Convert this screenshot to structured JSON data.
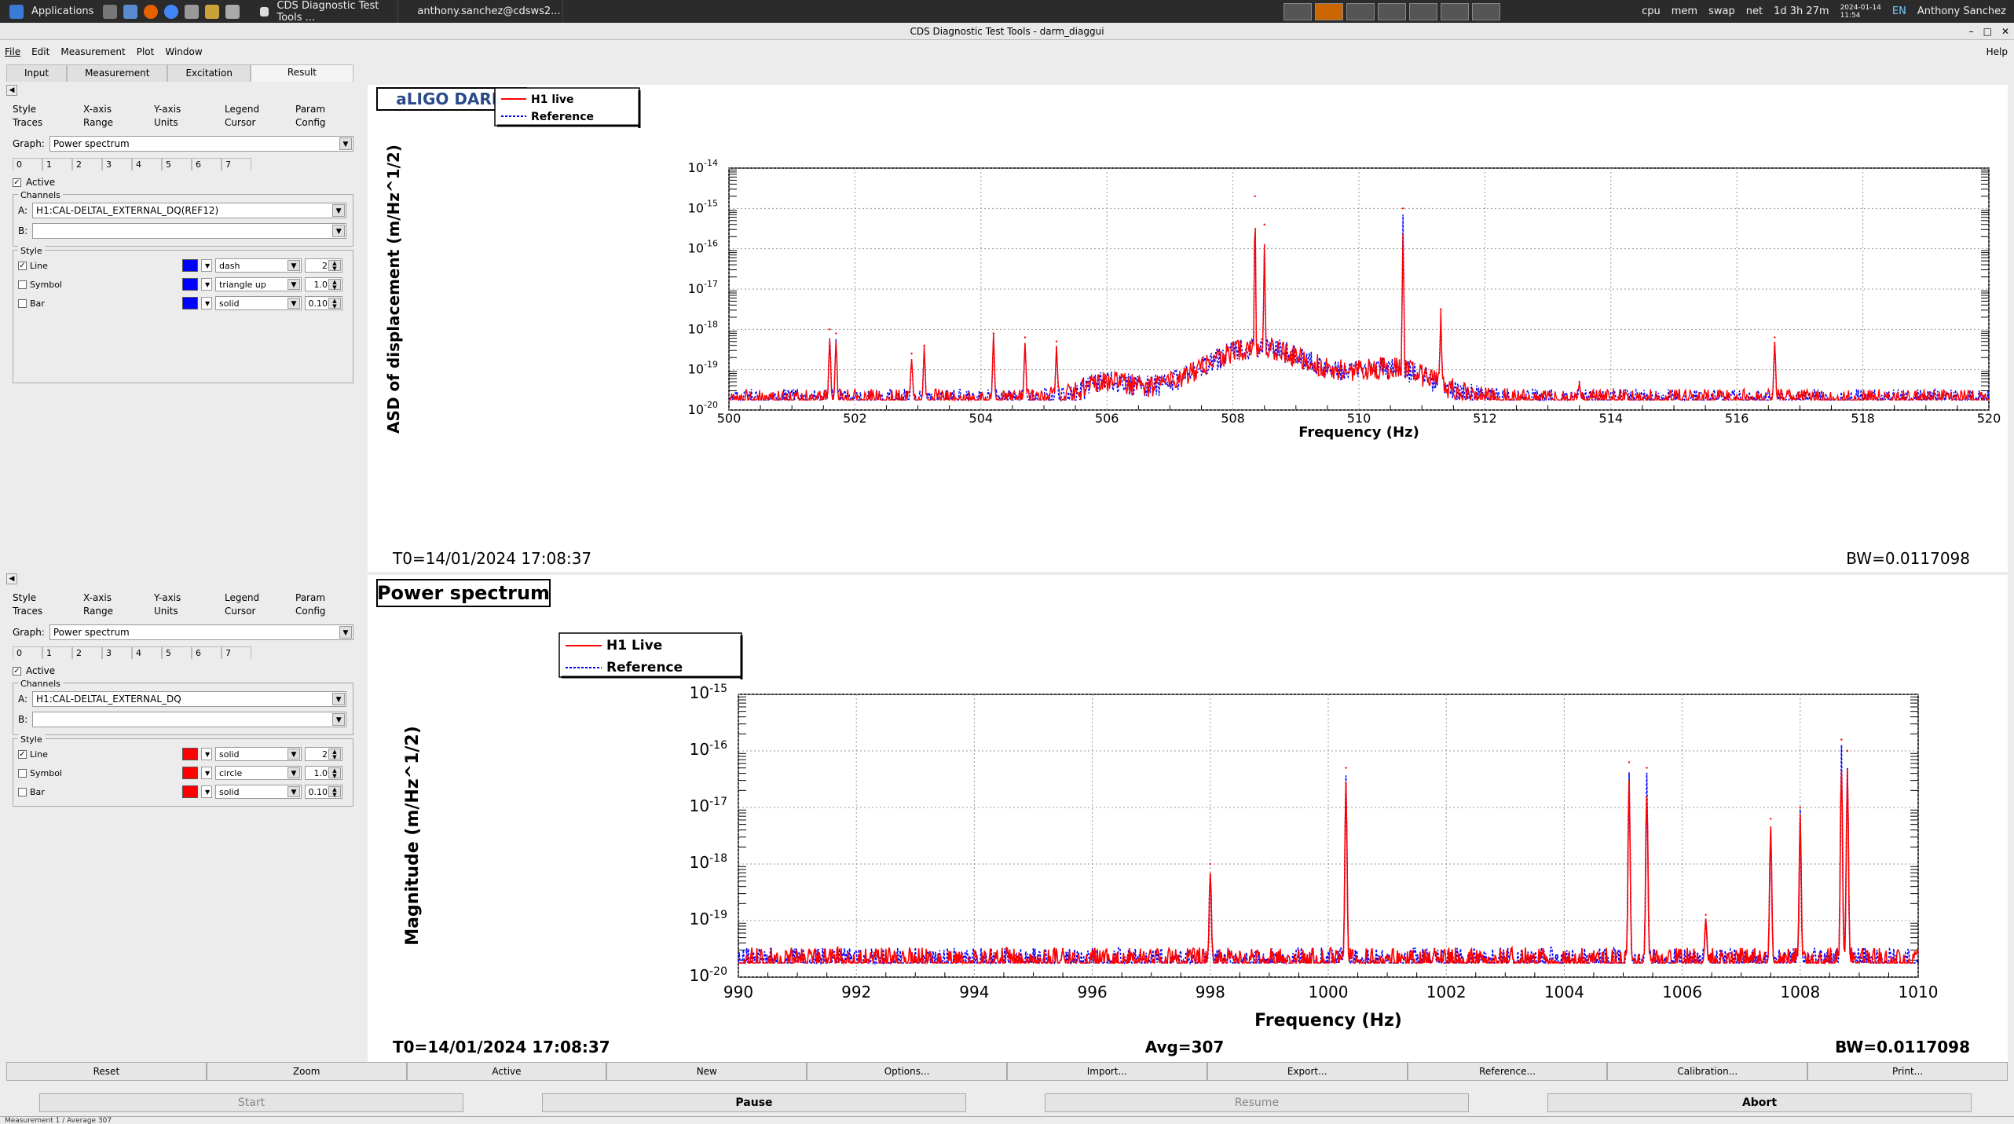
{
  "taskbar": {
    "applications": "Applications",
    "task1": "CDS Diagnostic Test Tools ...",
    "task2": "anthony.sanchez@cdsws2...",
    "tray": [
      "cpu",
      "mem",
      "swap",
      "net"
    ],
    "uptime": "1d 3h 27m",
    "date": "2024-01-14",
    "time": "11:54",
    "lang": "EN",
    "user": "Anthony Sanchez"
  },
  "window": {
    "title": "CDS Diagnostic Test Tools - darm_diaggui"
  },
  "menu": [
    "File",
    "Edit",
    "Measurement",
    "Plot",
    "Window"
  ],
  "help": "Help",
  "main_tabs": [
    "Input",
    "Measurement",
    "Excitation",
    "Result"
  ],
  "panels": [
    {
      "subtabs_r1": [
        "Style",
        "X-axis",
        "Y-axis",
        "Legend",
        "Param"
      ],
      "subtabs_r2": [
        "Traces",
        "Range",
        "Units",
        "Cursor",
        "Config"
      ],
      "graph_label": "Graph:",
      "graph_value": "Power spectrum",
      "trace_tabs": [
        "0",
        "1",
        "2",
        "3",
        "4",
        "5",
        "6",
        "7"
      ],
      "active_label": "Active",
      "channels_label": "Channels",
      "chan_a_label": "A:",
      "chan_a": "H1:CAL-DELTAL_EXTERNAL_DQ(REF12)",
      "chan_b_label": "B:",
      "style_label": "Style",
      "line_label": "Line",
      "line_style": "dash",
      "line_width": "2",
      "symbol_label": "Symbol",
      "symbol_style": "triangle up",
      "symbol_size": "1.0",
      "bar_label": "Bar",
      "bar_style": "solid",
      "bar_width": "0.10",
      "color": "#0000ff"
    },
    {
      "subtabs_r1": [
        "Style",
        "X-axis",
        "Y-axis",
        "Legend",
        "Param"
      ],
      "subtabs_r2": [
        "Traces",
        "Range",
        "Units",
        "Cursor",
        "Config"
      ],
      "graph_label": "Graph:",
      "graph_value": "Power spectrum",
      "trace_tabs": [
        "0",
        "1",
        "2",
        "3",
        "4",
        "5",
        "6",
        "7"
      ],
      "active_label": "Active",
      "channels_label": "Channels",
      "chan_a_label": "A:",
      "chan_a": "H1:CAL-DELTAL_EXTERNAL_DQ",
      "chan_b_label": "B:",
      "style_label": "Style",
      "line_label": "Line",
      "line_style": "solid",
      "line_width": "2",
      "symbol_label": "Symbol",
      "symbol_style": "circle",
      "symbol_size": "1.0",
      "bar_label": "Bar",
      "bar_style": "solid",
      "bar_width": "0.10",
      "color": "#ff0000"
    }
  ],
  "chart_data": [
    {
      "type": "line",
      "title": "aLIGO DARM",
      "xlabel": "Frequency (Hz)",
      "ylabel": "ASD of displacement (m/Hz^1/2)",
      "xlim": [
        500,
        520
      ],
      "ylim_log10": [
        -20,
        -14
      ],
      "x_ticks": [
        "500",
        "502",
        "504",
        "506",
        "508",
        "510",
        "512",
        "514",
        "516",
        "518",
        "520"
      ],
      "y_ticks": [
        "10^-20",
        "10^-19",
        "10^-18",
        "10^-17",
        "10^-16",
        "10^-15",
        "10^-14"
      ],
      "legend": [
        "H1 live",
        "Reference"
      ],
      "peaks": [
        {
          "x": 501.6,
          "y": -18.0
        },
        {
          "x": 501.7,
          "y": -18.1
        },
        {
          "x": 502.9,
          "y": -18.6
        },
        {
          "x": 503.1,
          "y": -18.4
        },
        {
          "x": 504.2,
          "y": -18.1
        },
        {
          "x": 504.7,
          "y": -18.2
        },
        {
          "x": 505.2,
          "y": -18.3
        },
        {
          "x": 508.35,
          "y": -14.7
        },
        {
          "x": 508.5,
          "y": -15.4
        },
        {
          "x": 510.7,
          "y": -15.0
        },
        {
          "x": 511.3,
          "y": -17.5
        },
        {
          "x": 513.5,
          "y": -19.3
        },
        {
          "x": 516.6,
          "y": -18.2
        }
      ],
      "t0": "T0=14/01/2024 17:08:37",
      "bw": "BW=0.0117098",
      "colors": {
        "live": "#ff0000",
        "ref": "#0000ff"
      }
    },
    {
      "type": "line",
      "title": "Power spectrum",
      "xlabel": "Frequency (Hz)",
      "ylabel": "Magnitude (m/Hz^1/2)",
      "xlim": [
        990,
        1010
      ],
      "ylim_log10": [
        -20,
        -15
      ],
      "x_ticks": [
        "990",
        "992",
        "994",
        "996",
        "998",
        "1000",
        "1002",
        "1004",
        "1006",
        "1008",
        "1010"
      ],
      "y_ticks": [
        "10^-20",
        "10^-19",
        "10^-18",
        "10^-17",
        "10^-16",
        "10^-15"
      ],
      "legend": [
        "H1 Live",
        "Reference"
      ],
      "peaks": [
        {
          "x": 995.5,
          "y": -19.5
        },
        {
          "x": 998.0,
          "y": -18.0
        },
        {
          "x": 1000.3,
          "y": -16.3
        },
        {
          "x": 1001.8,
          "y": -19.5
        },
        {
          "x": 1003.1,
          "y": -19.5
        },
        {
          "x": 1005.1,
          "y": -16.2
        },
        {
          "x": 1005.4,
          "y": -16.3
        },
        {
          "x": 1006.4,
          "y": -18.9
        },
        {
          "x": 1007.5,
          "y": -17.2
        },
        {
          "x": 1008.0,
          "y": -17.0
        },
        {
          "x": 1008.7,
          "y": -15.8
        },
        {
          "x": 1008.8,
          "y": -16.0
        }
      ],
      "t0": "T0=14/01/2024 17:08:37",
      "avg": "Avg=307",
      "bw": "BW=0.0117098",
      "colors": {
        "live": "#ff0000",
        "ref": "#0000ff"
      }
    }
  ],
  "buttons": [
    "Reset",
    "Zoom",
    "Active",
    "New",
    "Options...",
    "Import...",
    "Export...",
    "Reference...",
    "Calibration...",
    "Print..."
  ],
  "control_buttons": [
    "Start",
    "Pause",
    "Resume",
    "Abort"
  ],
  "status": "Measurement 1 / Average 307"
}
